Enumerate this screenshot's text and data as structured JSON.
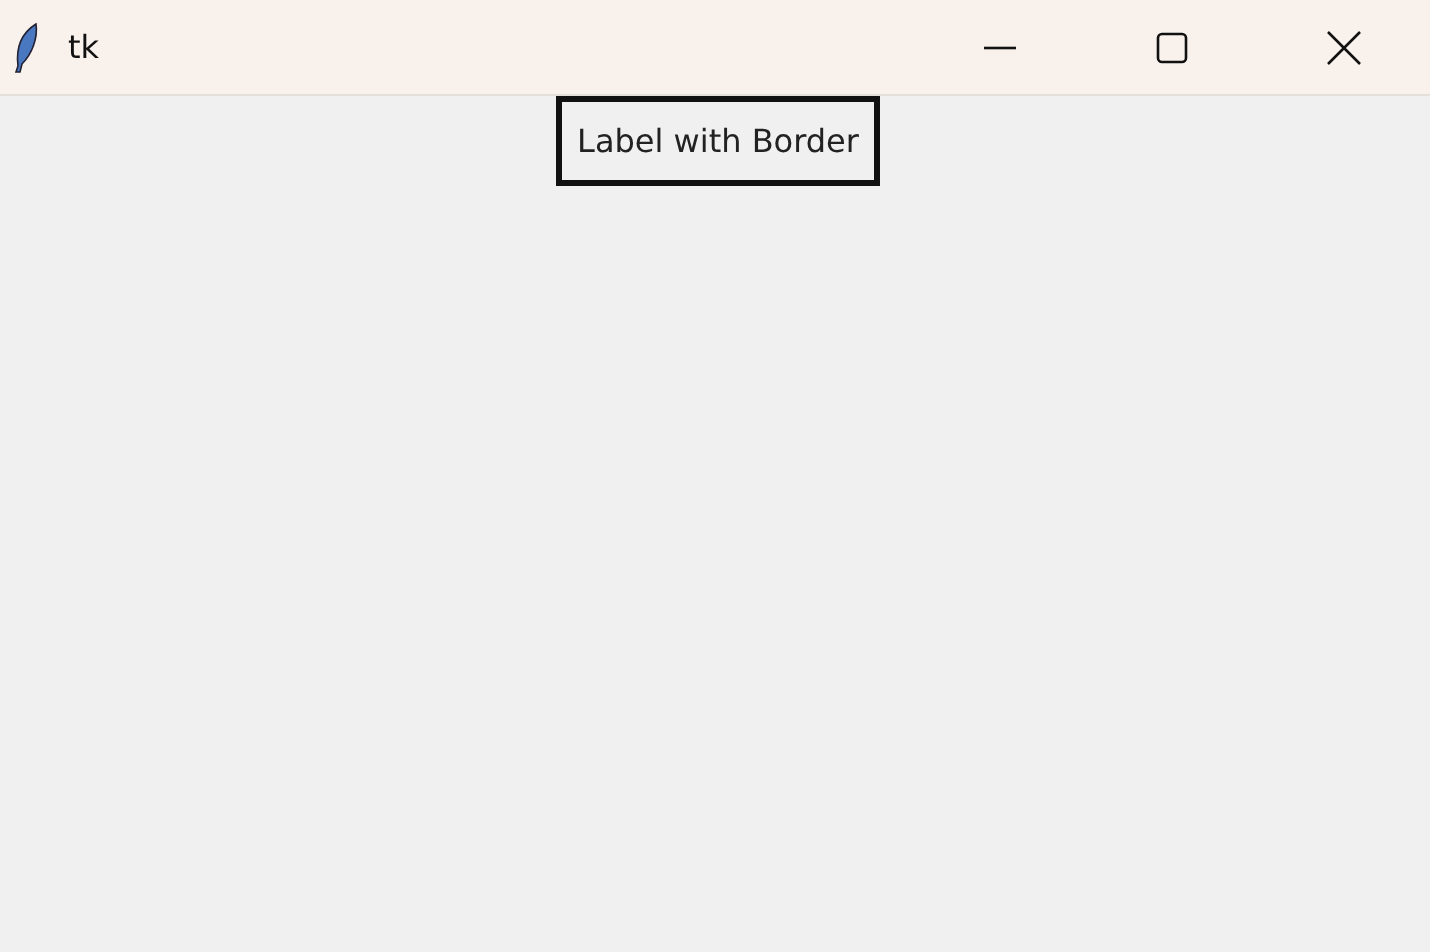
{
  "window": {
    "title": "tk"
  },
  "label": {
    "text": "Label with Border"
  }
}
